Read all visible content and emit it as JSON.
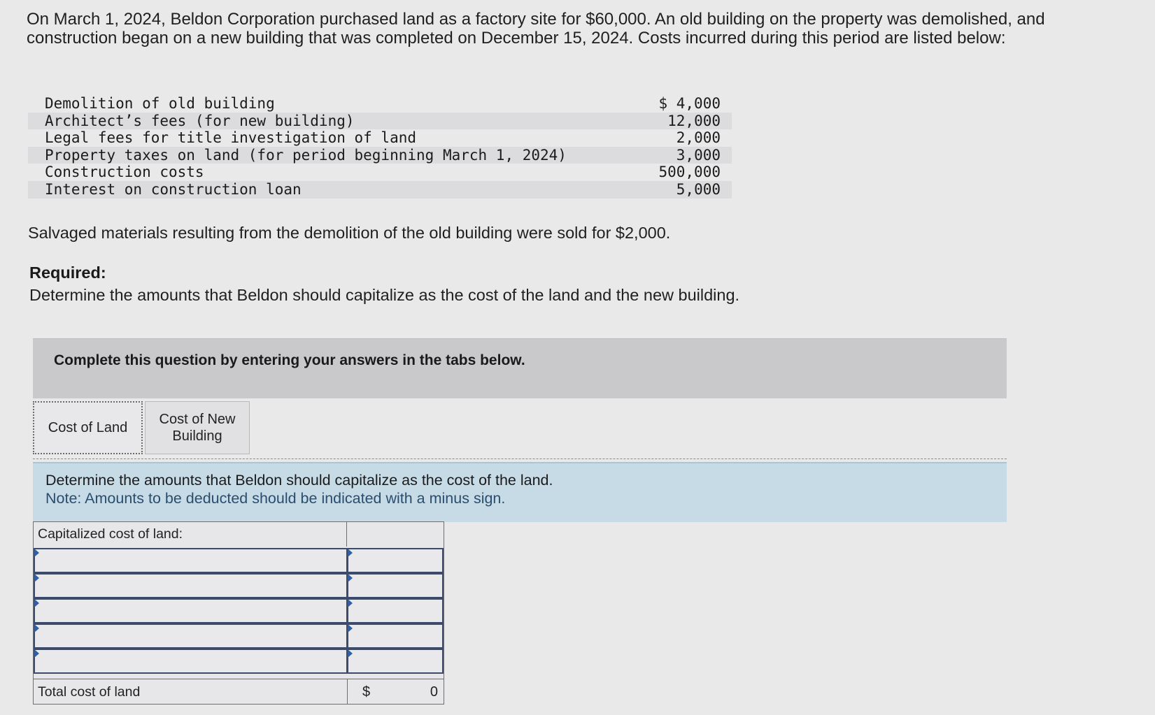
{
  "intro": {
    "text": "On March 1, 2024, Beldon Corporation purchased land as a factory site for $60,000. An old building on the property was demolished, and construction began on a new building that was completed on December 15, 2024. Costs incurred during this period are listed below:"
  },
  "costs": [
    {
      "label": "Demolition of old building",
      "amount": "$ 4,000"
    },
    {
      "label": "Architect’s fees (for new building)",
      "amount": "12,000"
    },
    {
      "label": "Legal fees for title investigation of land",
      "amount": "2,000"
    },
    {
      "label": "Property taxes on land (for period beginning March 1, 2024)",
      "amount": "3,000"
    },
    {
      "label": "Construction costs",
      "amount": "500,000"
    },
    {
      "label": "Interest on construction loan",
      "amount": "5,000"
    }
  ],
  "salvage": {
    "text": "Salvaged materials resulting from the demolition of the old building were sold for $2,000."
  },
  "required": {
    "heading": "Required:",
    "text": "Determine the amounts that Beldon should capitalize as the cost of the land and the new building."
  },
  "instructions": {
    "banner": "Complete this question by entering your answers in the tabs below."
  },
  "tabs": [
    {
      "label": "Cost of Land",
      "active": true
    },
    {
      "label": "Cost of New Building",
      "active": false
    }
  ],
  "panel": {
    "line1": "Determine the amounts that Beldon should capitalize as the cost of the land.",
    "line2": "Note: Amounts to be deducted should be indicated with a minus sign."
  },
  "land_table": {
    "header": "Capitalized cost of land:",
    "rows": [
      {
        "description": "",
        "amount": ""
      },
      {
        "description": "",
        "amount": ""
      },
      {
        "description": "",
        "amount": ""
      },
      {
        "description": "",
        "amount": ""
      },
      {
        "description": "",
        "amount": ""
      }
    ],
    "total_label": "Total cost of land",
    "total_currency": "$",
    "total_value": "0"
  },
  "colors": {
    "page_bg": "#e9e9ea",
    "banner_bg": "#c9c9cb",
    "panel_bg": "#c7dbe7",
    "note_text": "#2a4d6e",
    "input_border": "#3c4a6b",
    "input_marker": "#2e5fa8"
  }
}
